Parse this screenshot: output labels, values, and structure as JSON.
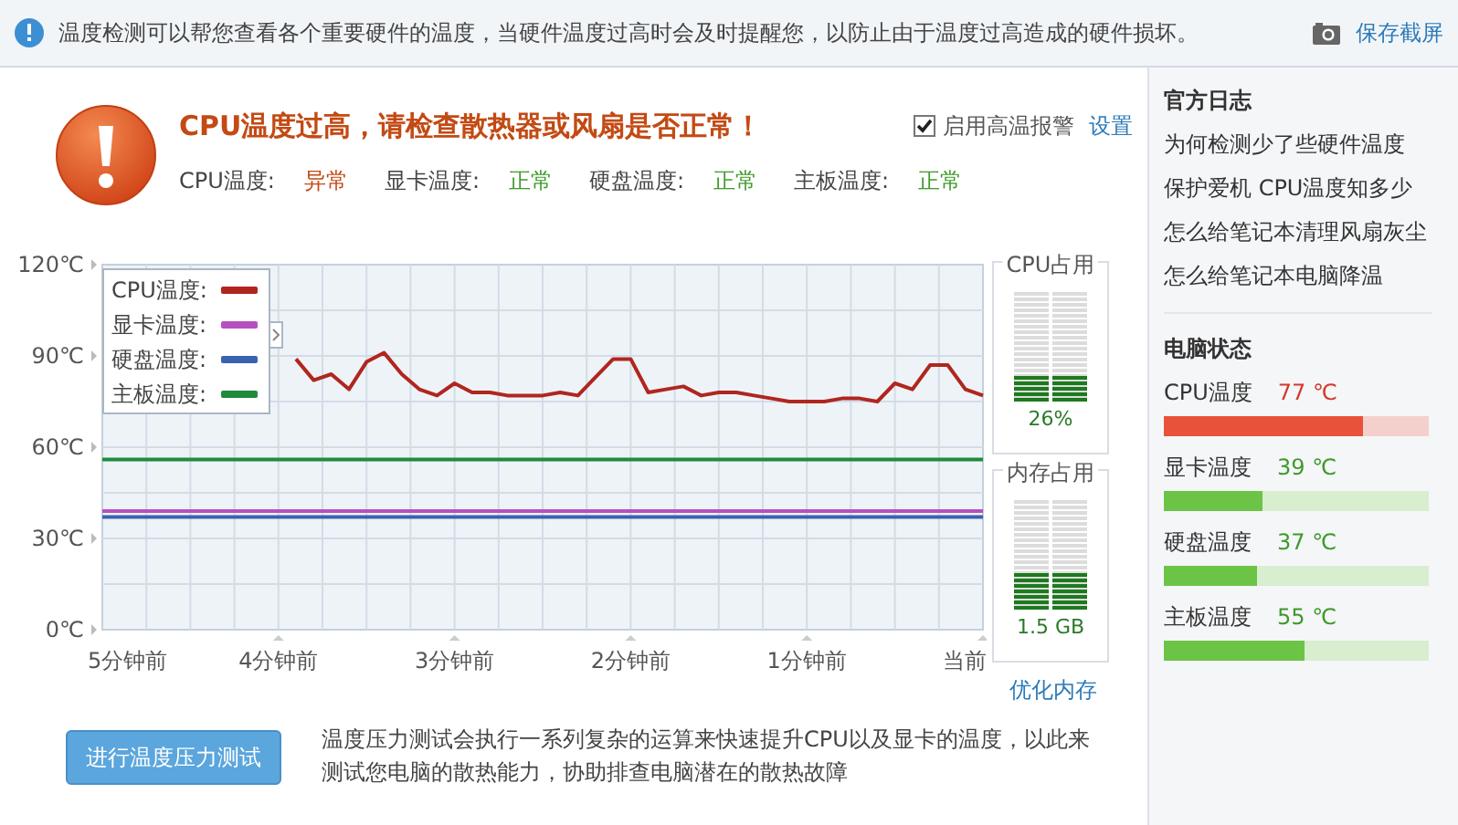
{
  "info_bar": {
    "text": "温度检测可以帮您查看各个重要硬件的温度，当硬件温度过高时会及时提醒您，以防止由于温度过高造成的硬件损坏。",
    "screenshot_link": "保存截屏"
  },
  "alert": {
    "title": "CPU温度过高，请检查散热器或风扇是否正常！",
    "alarm_checkbox": {
      "label": "启用高温报警",
      "checked": true
    },
    "settings_link": "设置"
  },
  "statuses": [
    {
      "label": "CPU温度:",
      "value": "异常",
      "kind": "abnormal"
    },
    {
      "label": "显卡温度:",
      "value": "正常",
      "kind": "normal"
    },
    {
      "label": "硬盘温度:",
      "value": "正常",
      "kind": "normal"
    },
    {
      "label": "主板温度:",
      "value": "正常",
      "kind": "normal"
    }
  ],
  "chart": {
    "chart_data": {
      "type": "line",
      "grid": true,
      "legend": true,
      "x": [
        5,
        4.9,
        4.8,
        4.7,
        4.6,
        4.5,
        4.4,
        4.3,
        4.2,
        4.1,
        4,
        3.9,
        3.8,
        3.7,
        3.6,
        3.5,
        3.4,
        3.3,
        3.2,
        3.1,
        3,
        2.9,
        2.8,
        2.7,
        2.6,
        2.5,
        2.4,
        2.3,
        2.2,
        2.1,
        2,
        1.9,
        1.8,
        1.7,
        1.6,
        1.5,
        1.4,
        1.3,
        1.2,
        1.1,
        1,
        0.9,
        0.8,
        0.7,
        0.6,
        0.5,
        0.4,
        0.3,
        0.2,
        0.1,
        0
      ],
      "series": [
        {
          "name": "CPU温度:",
          "color": "#b0261e",
          "values": [
            null,
            null,
            null,
            null,
            null,
            null,
            null,
            null,
            null,
            null,
            null,
            89,
            82,
            84,
            79,
            88,
            91,
            84,
            79,
            77,
            81,
            78,
            78,
            77,
            77,
            77,
            78,
            77,
            83,
            89,
            89,
            78,
            79,
            80,
            77,
            78,
            78,
            77,
            76,
            75,
            75,
            75,
            76,
            76,
            75,
            81,
            79,
            87,
            87,
            79,
            77
          ]
        },
        {
          "name": "显卡温度:",
          "color": "#b64fbf",
          "values": [
            39,
            39,
            39,
            39,
            39,
            39,
            39,
            39,
            39,
            39,
            39,
            39,
            39,
            39,
            39,
            39,
            39,
            39,
            39,
            39,
            39,
            39,
            39,
            39,
            39,
            39,
            39,
            39,
            39,
            39,
            39,
            39,
            39,
            39,
            39,
            39,
            39,
            39,
            39,
            39,
            39,
            39,
            39,
            39,
            39,
            39,
            39,
            39,
            39,
            39,
            39
          ]
        },
        {
          "name": "硬盘温度:",
          "color": "#3b62b0",
          "values": [
            37,
            37,
            37,
            37,
            37,
            37,
            37,
            37,
            37,
            37,
            37,
            37,
            37,
            37,
            37,
            37,
            37,
            37,
            37,
            37,
            37,
            37,
            37,
            37,
            37,
            37,
            37,
            37,
            37,
            37,
            37,
            37,
            37,
            37,
            37,
            37,
            37,
            37,
            37,
            37,
            37,
            37,
            37,
            37,
            37,
            37,
            37,
            37,
            37,
            37,
            37
          ]
        },
        {
          "name": "主板温度:",
          "color": "#1f8a3c",
          "values": [
            56,
            56,
            56,
            56,
            56,
            56,
            56,
            56,
            56,
            56,
            56,
            56,
            56,
            56,
            56,
            56,
            56,
            56,
            56,
            56,
            56,
            56,
            56,
            56,
            56,
            56,
            56,
            56,
            56,
            56,
            56,
            56,
            56,
            56,
            56,
            56,
            56,
            56,
            56,
            56,
            56,
            56,
            56,
            56,
            56,
            56,
            56,
            56,
            56,
            56,
            56
          ]
        }
      ],
      "xlim": [
        5,
        0
      ],
      "ylim": [
        0,
        120
      ],
      "xticks": [
        {
          "value": 5,
          "label": "5分钟前"
        },
        {
          "value": 4,
          "label": "4分钟前"
        },
        {
          "value": 3,
          "label": "3分钟前"
        },
        {
          "value": 2,
          "label": "2分钟前"
        },
        {
          "value": 1,
          "label": "1分钟前"
        },
        {
          "value": 0,
          "label": "当前"
        }
      ],
      "yticks": [
        {
          "value": 0,
          "label": "0℃"
        },
        {
          "value": 30,
          "label": "30℃"
        },
        {
          "value": 60,
          "label": "60℃"
        },
        {
          "value": 90,
          "label": "90℃"
        },
        {
          "value": 120,
          "label": "120℃"
        }
      ]
    }
  },
  "meters": [
    {
      "title": "CPU占用",
      "level": 0.26,
      "reading": "26%"
    },
    {
      "title": "内存占用",
      "level": 0.35,
      "reading": "1.5 GB"
    }
  ],
  "optimize_link": "优化内存",
  "stress_test": {
    "button": "进行温度压力测试",
    "description": "温度压力测试会执行一系列复杂的运算来快速提升CPU以及显卡的温度，以此来测试您电脑的散热能力，协助排查电脑潜在的散热故障"
  },
  "sidebar": {
    "news_title": "官方日志",
    "news": [
      "为何检测少了些硬件温度",
      "保护爱机 CPU温度知多少",
      "怎么给笔记本清理风扇灰尘",
      "怎么给笔记本电脑降温"
    ],
    "status_title": "电脑状态",
    "status_items": [
      {
        "label": "CPU温度",
        "reading": "77 ℃",
        "level": 0.75,
        "kind": "hot"
      },
      {
        "label": "显卡温度",
        "reading": "39 ℃",
        "level": 0.37,
        "kind": "normal"
      },
      {
        "label": "硬盘温度",
        "reading": "37 ℃",
        "level": 0.35,
        "kind": "normal"
      },
      {
        "label": "主板温度",
        "reading": "55 ℃",
        "level": 0.53,
        "kind": "normal"
      }
    ]
  }
}
